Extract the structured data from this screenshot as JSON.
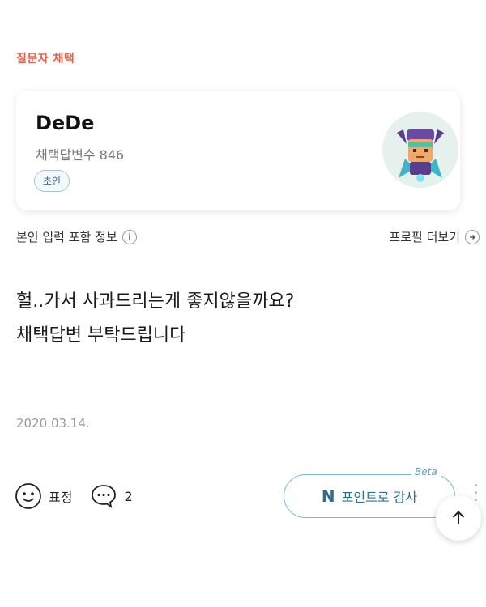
{
  "section_label": "질문자 채택",
  "profile": {
    "name": "DeDe",
    "count_label": "채택답변수 846",
    "badge": "초인",
    "avatar_icon": "robot-avatar-icon"
  },
  "meta": {
    "info_label": "본인 입력 포함 정보",
    "info_icon_glyph": "i",
    "more_label": "프로필 더보기"
  },
  "answer": {
    "line1": "헐..가서 사과드리는게 좋지않을까요?",
    "line2": "채택답변 부탁드립니다"
  },
  "date": "2020.03.14.",
  "actions": {
    "emotion_label": "표정",
    "comment_count": "2",
    "thanks_mark": "N",
    "thanks_label": "포인트로 감사",
    "beta_label": "Beta"
  },
  "colors": {
    "accent": "#e0634a",
    "teal": "#2d6f8a",
    "border": "#7fb6cc"
  }
}
